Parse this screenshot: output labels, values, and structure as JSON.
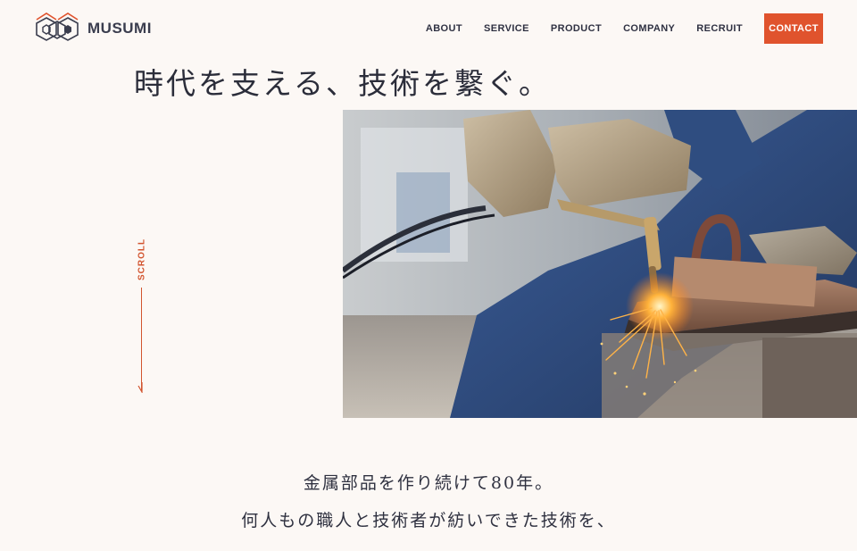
{
  "brand": {
    "name": "MUSUMI",
    "accent_color": "#e0532d",
    "text_color": "#3a3d4e"
  },
  "nav": {
    "items": [
      {
        "label": "ABOUT"
      },
      {
        "label": "SERVICE"
      },
      {
        "label": "PRODUCT"
      },
      {
        "label": "COMPANY"
      },
      {
        "label": "RECRUIT"
      }
    ],
    "contact_label": "CONTACT"
  },
  "hero": {
    "headline": "時代を支える、技術を繋ぐ。",
    "image_icon": "welding-photo"
  },
  "scroll": {
    "label": "SCROLL",
    "icon": "arrow-down-icon"
  },
  "intro": {
    "lines": [
      "金属部品を作り続けて80年。",
      "何人もの職人と技術者が紡いできた技術を、"
    ]
  }
}
